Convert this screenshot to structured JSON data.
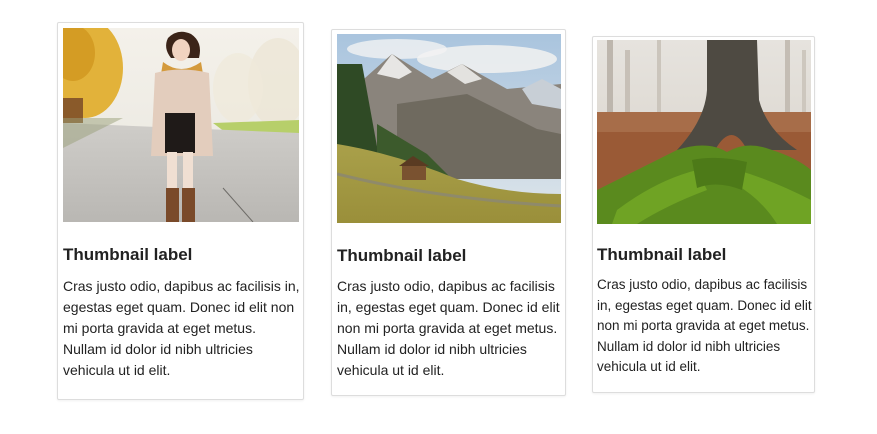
{
  "thumbnails": [
    {
      "image_alt": "Woman in autumn coat and scarf walking on a road",
      "label": "Thumbnail label",
      "text": "Cras justo odio, dapibus ac facilisis in, egestas eget quam. Donec id elit non mi porta gravida at eget metus. Nullam id dolor id nibh ultricies vehicula ut id elit."
    },
    {
      "image_alt": "Mountain valley with a wooden hut on a green meadow",
      "label": "Thumbnail label",
      "text": "Cras justo odio, dapibus ac facilisis in, egestas eget quam. Donec id elit non mi porta gravida at eget metus. Nullam id dolor id nibh ultricies vehicula ut id elit."
    },
    {
      "image_alt": "Moss-covered tree roots in a foggy forest",
      "label": "Thumbnail label",
      "text": "Cras justo odio, dapibus ac facilisis in, egestas eget quam. Donec id elit non mi porta gravida at eget metus. Nullam id dolor id nibh ultricies vehicula ut id elit."
    }
  ],
  "colors": {
    "card_border": "#dddddd",
    "text": "#222222",
    "background": "#ffffff"
  }
}
